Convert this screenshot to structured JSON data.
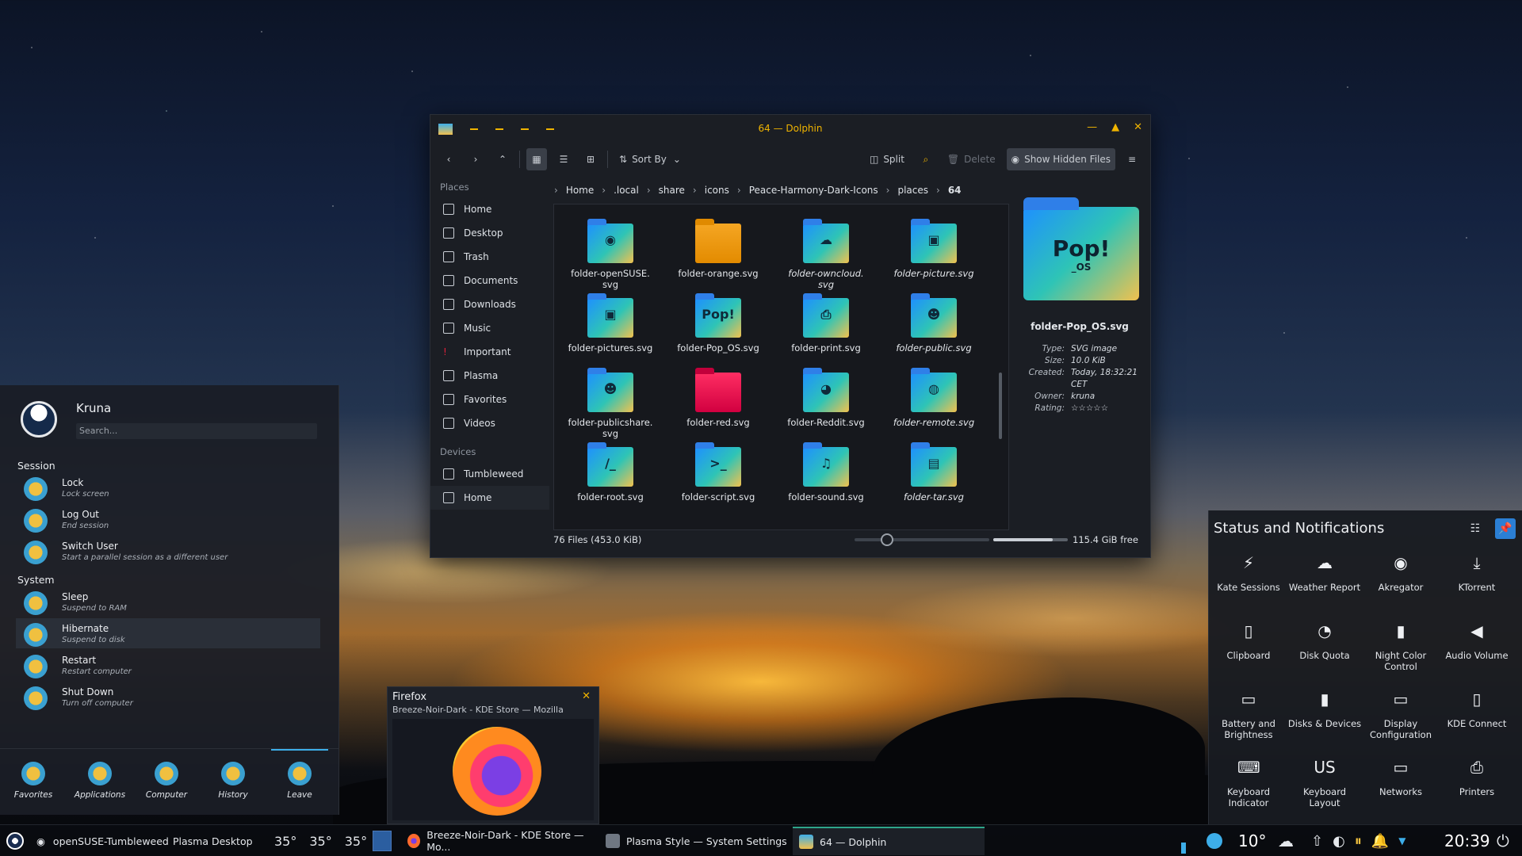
{
  "dolphin": {
    "title": "64 — Dolphin",
    "toolbar": {
      "sort": "Sort By",
      "split": "Split",
      "delete": "Delete",
      "hidden": "Show Hidden Files"
    },
    "places_header": "Places",
    "places": [
      "Home",
      "Desktop",
      "Trash",
      "Documents",
      "Downloads",
      "Music",
      "Important",
      "Plasma",
      "Favorites",
      "Videos"
    ],
    "devices_header": "Devices",
    "devices": [
      "Tumbleweed",
      "Home"
    ],
    "breadcrumb": [
      "Home",
      ".local",
      "share",
      "icons",
      "Peace-Harmony-Dark-Icons",
      "places",
      "64"
    ],
    "files": [
      {
        "name": "folder-openSUSE.\nsvg",
        "style": "grad",
        "glyph": "◉"
      },
      {
        "name": "folder-orange.svg",
        "style": "orange",
        "glyph": ""
      },
      {
        "name": "folder-owncloud.\nsvg",
        "style": "grad",
        "glyph": "☁"
      },
      {
        "name": "folder-picture.svg",
        "style": "grad",
        "glyph": "▣"
      },
      {
        "name": "folder-pictures.svg",
        "style": "grad",
        "glyph": "▣"
      },
      {
        "name": "folder-Pop_OS.svg",
        "style": "grad",
        "glyph": "Pop!"
      },
      {
        "name": "folder-print.svg",
        "style": "grad",
        "glyph": "⎙"
      },
      {
        "name": "folder-public.svg",
        "style": "grad",
        "glyph": "☻"
      },
      {
        "name": "folder-publicshare.\nsvg",
        "style": "grad",
        "glyph": "☻"
      },
      {
        "name": "folder-red.svg",
        "style": "red",
        "glyph": ""
      },
      {
        "name": "folder-Reddit.svg",
        "style": "grad",
        "glyph": "◕"
      },
      {
        "name": "folder-remote.svg",
        "style": "grad",
        "glyph": "◍"
      },
      {
        "name": "folder-root.svg",
        "style": "grad",
        "glyph": "/_"
      },
      {
        "name": "folder-script.svg",
        "style": "grad",
        "glyph": ">_"
      },
      {
        "name": "folder-sound.svg",
        "style": "grad",
        "glyph": "♫"
      },
      {
        "name": "folder-tar.svg",
        "style": "grad",
        "glyph": "▤"
      }
    ],
    "preview": {
      "name": "folder-Pop_OS.svg",
      "big_text": "Pop!",
      "small_text": "_OS",
      "meta": [
        [
          "Type:",
          "SVG image"
        ],
        [
          "Size:",
          "10.0 KiB"
        ],
        [
          "Created:",
          "Today, 18:32:21 CET"
        ],
        [
          "Owner:",
          "kruna"
        ],
        [
          "Rating:",
          "☆☆☆☆☆"
        ]
      ]
    },
    "status_files": "76 Files (453.0 KiB)",
    "zoom_fraction": 0.24,
    "free_space": "115.4 GiB free",
    "free_fraction": 0.8
  },
  "launcher": {
    "user": "Kruna",
    "search_placeholder": "Search...",
    "session_header": "Session",
    "system_header": "System",
    "items": [
      {
        "t": "Lock",
        "s": "Lock screen"
      },
      {
        "t": "Log Out",
        "s": "End session"
      },
      {
        "t": "Switch User",
        "s": "Start a parallel session as a different user"
      },
      {
        "t": "Sleep",
        "s": "Suspend to RAM"
      },
      {
        "t": "Hibernate",
        "s": "Suspend to disk"
      },
      {
        "t": "Restart",
        "s": "Restart computer"
      },
      {
        "t": "Shut Down",
        "s": "Turn off computer"
      }
    ],
    "footer": [
      "Favorites",
      "Applications",
      "Computer",
      "History",
      "Leave"
    ]
  },
  "firefox_tip": {
    "title": "Firefox",
    "subtitle": "Breeze-Noir-Dark - KDE Store — Mozilla"
  },
  "notifications": {
    "title": "Status and Notifications",
    "items": [
      {
        "label": "Kate Sessions",
        "icon": "⚡"
      },
      {
        "label": "Weather Report",
        "icon": "☁"
      },
      {
        "label": "Akregator",
        "icon": "◉"
      },
      {
        "label": "KTorrent",
        "icon": "⤓"
      },
      {
        "label": "Clipboard",
        "icon": "▯"
      },
      {
        "label": "Disk Quota",
        "icon": "◔"
      },
      {
        "label": "Night Color\nControl",
        "icon": "▮"
      },
      {
        "label": "Audio Volume",
        "icon": "◀"
      },
      {
        "label": "Battery and\nBrightness",
        "icon": "▭"
      },
      {
        "label": "Disks & Devices",
        "icon": "▮"
      },
      {
        "label": "Display\nConfiguration",
        "icon": "▭"
      },
      {
        "label": "KDE Connect",
        "icon": "▯"
      },
      {
        "label": "Keyboard\nIndicator",
        "icon": "⌨"
      },
      {
        "label": "Keyboard\nLayout",
        "icon": "US"
      },
      {
        "label": "Networks",
        "icon": "▭"
      },
      {
        "label": "Printers",
        "icon": "⎙"
      }
    ]
  },
  "taskbar": {
    "distro": "openSUSE-Tumbleweed",
    "desktop": "Plasma Desktop",
    "temps": [
      "35°",
      "35°",
      "35°"
    ],
    "tasks": [
      "Breeze-Noir-Dark - KDE Store — Mo...",
      "Plasma Style — System Settings",
      "64 — Dolphin"
    ],
    "weather": "10°",
    "clock": "20:39"
  },
  "colors": {
    "accent": "#f0b400",
    "highlight": "#3daee9",
    "active_task": "#2ea58a"
  }
}
